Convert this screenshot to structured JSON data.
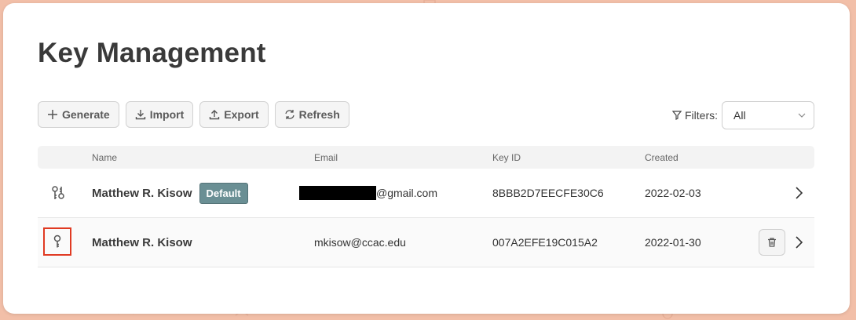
{
  "page": {
    "title": "Key Management"
  },
  "toolbar": {
    "generate_label": "Generate",
    "import_label": "Import",
    "export_label": "Export",
    "refresh_label": "Refresh"
  },
  "filters": {
    "label": "Filters:",
    "selected": "All"
  },
  "table": {
    "headers": {
      "name": "Name",
      "email": "Email",
      "key_id": "Key ID",
      "created": "Created"
    },
    "rows": [
      {
        "icon": "key-pair-icon",
        "name": "Matthew R. Kisow",
        "badge": "Default",
        "email_suffix": "@gmail.com",
        "email_redacted": true,
        "key_id": "8BBB2D7EECFE30C6",
        "created": "2022-02-03"
      },
      {
        "icon": "key-icon",
        "name": "Matthew R. Kisow",
        "email": "mkisow@ccac.edu",
        "key_id": "007A2EFE19C015A2",
        "created": "2022-01-30"
      }
    ]
  },
  "colors": {
    "badge": "#6a8f94",
    "highlight": "#e03a22",
    "background": "#f2bfa8"
  }
}
